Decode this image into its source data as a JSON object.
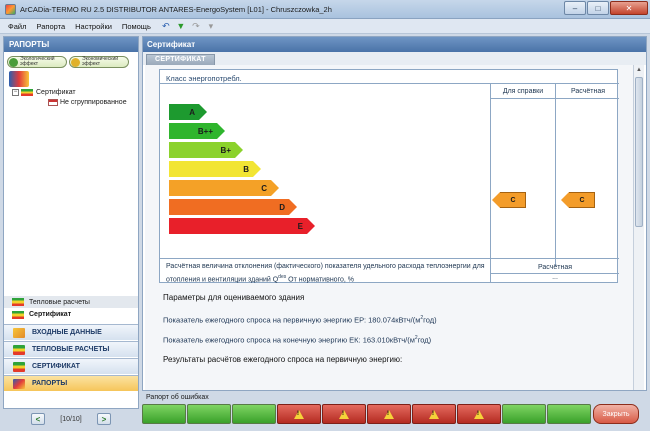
{
  "window": {
    "title": "ArCADia-TERMO RU 2.5 DISTRIBUTOR ANTARES-EnergoSystem [L01] - Chruszczowka_2h",
    "minimize": "–",
    "maximize": "□",
    "close": "✕"
  },
  "menu": {
    "file": "Файл",
    "reports": "Рапорта",
    "settings": "Настройки",
    "help": "Помощь"
  },
  "left": {
    "header": "РАПОРТЫ",
    "eco_effect": "Экологический эффект",
    "econ_effect": "Экономический эффект",
    "tree": {
      "root": "Сертификат",
      "child": "Не сгруппированное"
    },
    "sub_items": [
      "Тепловые расчеты",
      "Сертификат"
    ],
    "nav": [
      {
        "label": "ВХОДНЫЕ ДАННЫЕ"
      },
      {
        "label": "ТЕПЛОВЫЕ РАСЧЕТЫ"
      },
      {
        "label": "СЕРТИФИКАТ"
      },
      {
        "label": "РАПОРТЫ"
      }
    ],
    "pager": {
      "prev": "<",
      "text": "[10/10]",
      "next": ">"
    }
  },
  "main": {
    "header": "Сертификат",
    "tab": "СЕРТИФИКАТ",
    "cert": {
      "class_title": "Класс энергопотребл.",
      "col_ref": "Для справки",
      "col_calc": "Расчётная",
      "classes": [
        {
          "label": "A",
          "color": "#1d9a2f"
        },
        {
          "label": "B++",
          "color": "#2fb52d"
        },
        {
          "label": "B+",
          "color": "#8bd22c"
        },
        {
          "label": "B",
          "color": "#f2e534"
        },
        {
          "label": "C",
          "color": "#f4a127"
        },
        {
          "label": "D",
          "color": "#f06d22"
        },
        {
          "label": "E",
          "color": "#e8202a"
        }
      ],
      "ref_class": "C",
      "calc_class": "C",
      "deviation_note": "Расчётная величина отклонения (фактического) показателя удельного расхода теплоэнергии для отопления и вентиляции зданий Q",
      "deviation_sup": "des",
      "deviation_tail": " От нормативного, %",
      "calc_sub": "Расчётная",
      "calc_sub_val": "..."
    },
    "params": {
      "title": "Параметры для оцениваемого здания",
      "ep_prefix": "Показатель ежегодного спроса на первичную энергию ЕР: 180.074кВтч/(м",
      "ep_sup": "2",
      "ep_suffix": "год)",
      "ek_prefix": "Показатель ежегодного спроса на конечную энергию ЕК: 163.010кВтч/(м",
      "ek_sup": "2",
      "ek_suffix": "год)",
      "results": "Результаты расчётов ежегодного спроса на первичную энергию:"
    }
  },
  "errors": {
    "label": "Рапорт об ошибках",
    "cells": [
      "ok",
      "ok",
      "ok",
      "err",
      "err",
      "err",
      "err",
      "err",
      "ok",
      "ok"
    ],
    "close": "Закрыть"
  }
}
